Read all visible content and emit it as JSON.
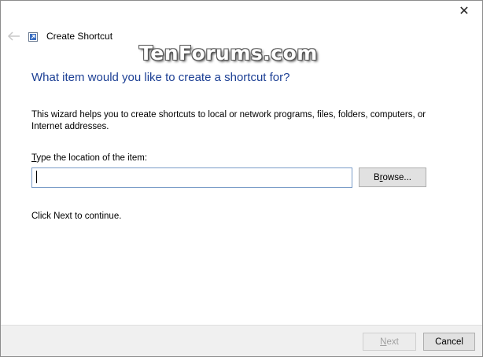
{
  "window": {
    "close_glyph": "✕",
    "nav_title": "Create Shortcut"
  },
  "watermark": "TenForums.com",
  "wizard": {
    "heading": "What item would you like to create a shortcut for?",
    "description": "This wizard helps you to create shortcuts to local or network programs, files, folders, computers, or Internet addresses.",
    "location_label_accel": "T",
    "location_label_rest": "ype the location of the item:",
    "location_value": "",
    "browse_accel": "r",
    "browse_pre": "B",
    "browse_post": "owse...",
    "continue_text": "Click Next to continue."
  },
  "footer": {
    "next_accel": "N",
    "next_rest": "ext",
    "cancel_label": "Cancel"
  },
  "icons": {
    "back": "back-arrow-icon",
    "app": "shortcut-icon",
    "close": "close-icon"
  },
  "colors": {
    "heading": "#1c3f94",
    "input_border": "#7a9cc8",
    "footer_bg": "#f0f0f0"
  }
}
